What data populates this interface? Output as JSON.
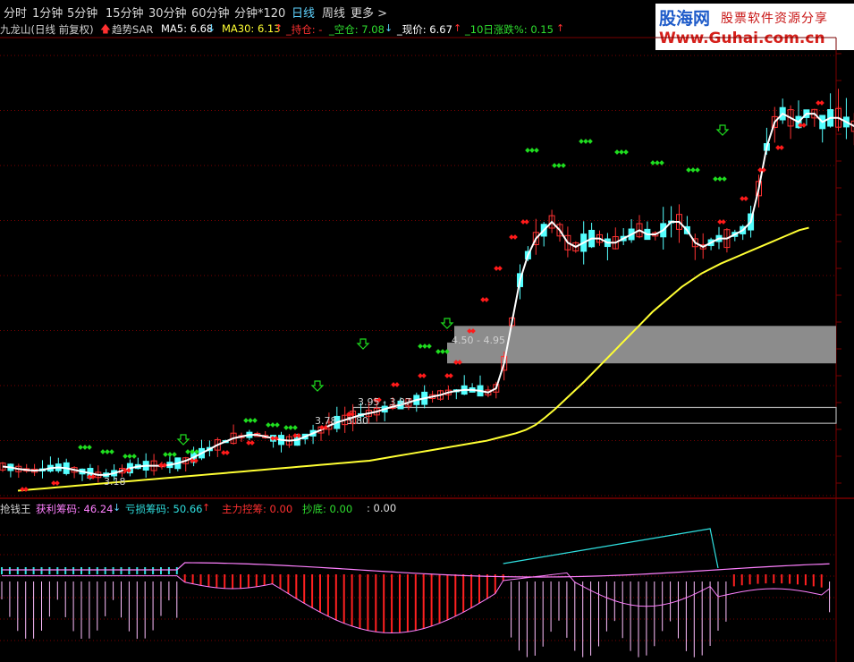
{
  "toolbar": {
    "tabs": [
      {
        "label": "分时"
      },
      {
        "label": "1分钟"
      },
      {
        "label": "5分钟"
      },
      {
        "label": "15分钟"
      },
      {
        "label": "30分钟"
      },
      {
        "label": "60分钟"
      },
      {
        "label": "分钟*120"
      },
      {
        "label": "日线"
      },
      {
        "label": "周线"
      },
      {
        "label": "更多 >"
      }
    ],
    "active_tab": "日线"
  },
  "watermark": {
    "brand": "股海网",
    "slogan": "股票软件资源分享",
    "url": "Www.Guhai.com.cn"
  },
  "main_legend": {
    "stock": "九龙山(日线 前复权)",
    "indicator": "趋势SAR",
    "ma5": "MA5: 6.68",
    "ma30": "MA30: 6.13",
    "hold": "_持仓: -",
    "empty": "_空仓: 7.08",
    "price": "_现价: 6.67",
    "change10": "_10日涨跌%: 0.15"
  },
  "sub_legend": {
    "name": "抢钱王",
    "profit": "获利筹码: 46.24",
    "loss": "亏损筹码: 50.66",
    "main_control": "主力控筹: 0.00",
    "bottom": "抄底: 0.00",
    "extra": ": 0.00"
  },
  "annotations": {
    "low_label": "3.18",
    "zone1": "3.78 - 3.80",
    "zone2": "3.95 - 3.97",
    "zone3": "4.50 - 4.95"
  },
  "colors": {
    "up": "#ff3232",
    "down": "#54ffff",
    "ma5": "#ffffff",
    "ma30": "#ffff33",
    "sar_up": "#ff1a1a",
    "sar_down": "#1fdc1f",
    "zone": "#8c8c8c",
    "grid": "#7a0000",
    "profit": "#ff80ff",
    "loss": "#2fe0e0",
    "hist_red": "#ff2020",
    "hist_white": "#ffbfff"
  },
  "chart_data": [
    {
      "type": "candlestick",
      "title": "九龙山(日线 前复权)",
      "ylim": [
        2.9,
        8.2
      ],
      "series": [
        {
          "name": "MA5",
          "values": [
            3.26,
            3.25,
            3.23,
            3.22,
            3.21,
            3.22,
            3.24,
            3.25,
            3.24,
            3.22,
            3.2,
            3.18,
            3.16,
            3.16,
            3.18,
            3.21,
            3.24,
            3.26,
            3.27,
            3.27,
            3.27,
            3.28,
            3.3,
            3.33,
            3.37,
            3.42,
            3.47,
            3.52,
            3.56,
            3.6,
            3.62,
            3.64,
            3.64,
            3.62,
            3.6,
            3.58,
            3.57,
            3.58,
            3.62,
            3.66,
            3.7,
            3.75,
            3.79,
            3.82,
            3.85,
            3.88,
            3.9,
            3.92,
            3.95,
            3.98,
            4.0,
            4.03,
            4.06,
            4.08,
            4.1,
            4.12,
            4.15,
            4.17,
            4.18,
            4.18,
            4.17,
            4.15,
            4.2,
            4.5,
            5.0,
            5.5,
            5.8,
            6.0,
            6.1,
            6.2,
            6.1,
            5.95,
            5.9,
            5.95,
            6.0,
            6.0,
            5.95,
            5.95,
            6.0,
            6.05,
            6.1,
            6.05,
            6.05,
            6.1,
            6.2,
            6.2,
            6.1,
            5.95,
            5.9,
            5.95,
            6.0,
            6.0,
            6.05,
            6.1,
            6.2,
            6.6,
            7.1,
            7.4,
            7.5,
            7.45,
            7.4,
            7.5,
            7.5,
            7.4,
            7.45,
            7.45,
            7.4,
            7.35
          ]
        },
        {
          "name": "MA30",
          "values": [
            2.97,
            2.98,
            2.99,
            3.0,
            3.01,
            3.02,
            3.03,
            3.04,
            3.05,
            3.06,
            3.07,
            3.08,
            3.09,
            3.1,
            3.11,
            3.12,
            3.13,
            3.14,
            3.15,
            3.16,
            3.17,
            3.18,
            3.19,
            3.2,
            3.21,
            3.22,
            3.23,
            3.24,
            3.25,
            3.26,
            3.27,
            3.28,
            3.29,
            3.3,
            3.31,
            3.32,
            3.33,
            3.35,
            3.37,
            3.39,
            3.41,
            3.43,
            3.45,
            3.47,
            3.49,
            3.51,
            3.53,
            3.55,
            3.57,
            3.6,
            3.63,
            3.66,
            3.7,
            3.76,
            3.85,
            3.95,
            4.06,
            4.17,
            4.28,
            4.4,
            4.52,
            4.64,
            4.76,
            4.88,
            5.0,
            5.12,
            5.22,
            5.32,
            5.42,
            5.5,
            5.58,
            5.64,
            5.7,
            5.75,
            5.8,
            5.85,
            5.9,
            5.95,
            6.0,
            6.05,
            6.1,
            6.13
          ]
        }
      ],
      "zones": [
        "3.78 - 3.80",
        "3.95 - 3.97",
        "4.50 - 4.95"
      ]
    },
    {
      "type": "line",
      "title": "抢钱王",
      "series": [
        {
          "name": "获利筹码",
          "value": 46.24
        },
        {
          "name": "亏损筹码",
          "value": 50.66
        },
        {
          "name": "主力控筹",
          "value": 0.0
        },
        {
          "name": "抄底",
          "value": 0.0
        }
      ]
    }
  ]
}
